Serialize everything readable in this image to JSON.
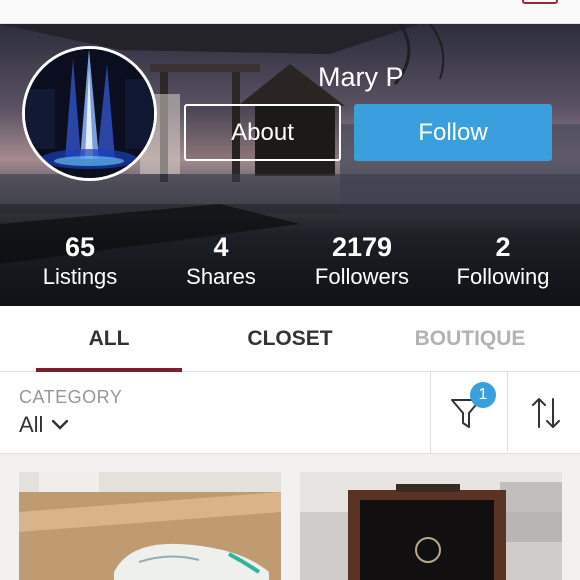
{
  "profile": {
    "name": "Mary P",
    "about_label": "About",
    "follow_label": "Follow"
  },
  "stats": [
    {
      "value": "65",
      "label": "Listings"
    },
    {
      "value": "4",
      "label": "Shares"
    },
    {
      "value": "2179",
      "label": "Followers"
    },
    {
      "value": "2",
      "label": "Following"
    }
  ],
  "tabs": [
    {
      "label": "ALL",
      "active": true
    },
    {
      "label": "CLOSET",
      "active": false
    },
    {
      "label": "BOUTIQUE",
      "active": false
    }
  ],
  "filter": {
    "category_label": "CATEGORY",
    "category_value": "All",
    "filter_count": "1"
  },
  "icons": {
    "filter": "funnel-icon",
    "sort": "sort-arrows-icon",
    "dropdown": "chevron-down-icon"
  },
  "colors": {
    "accent_blue": "#3aa0dd",
    "brand_maroon": "#7a1f2b",
    "inactive_tab": "#b5b2b2"
  }
}
